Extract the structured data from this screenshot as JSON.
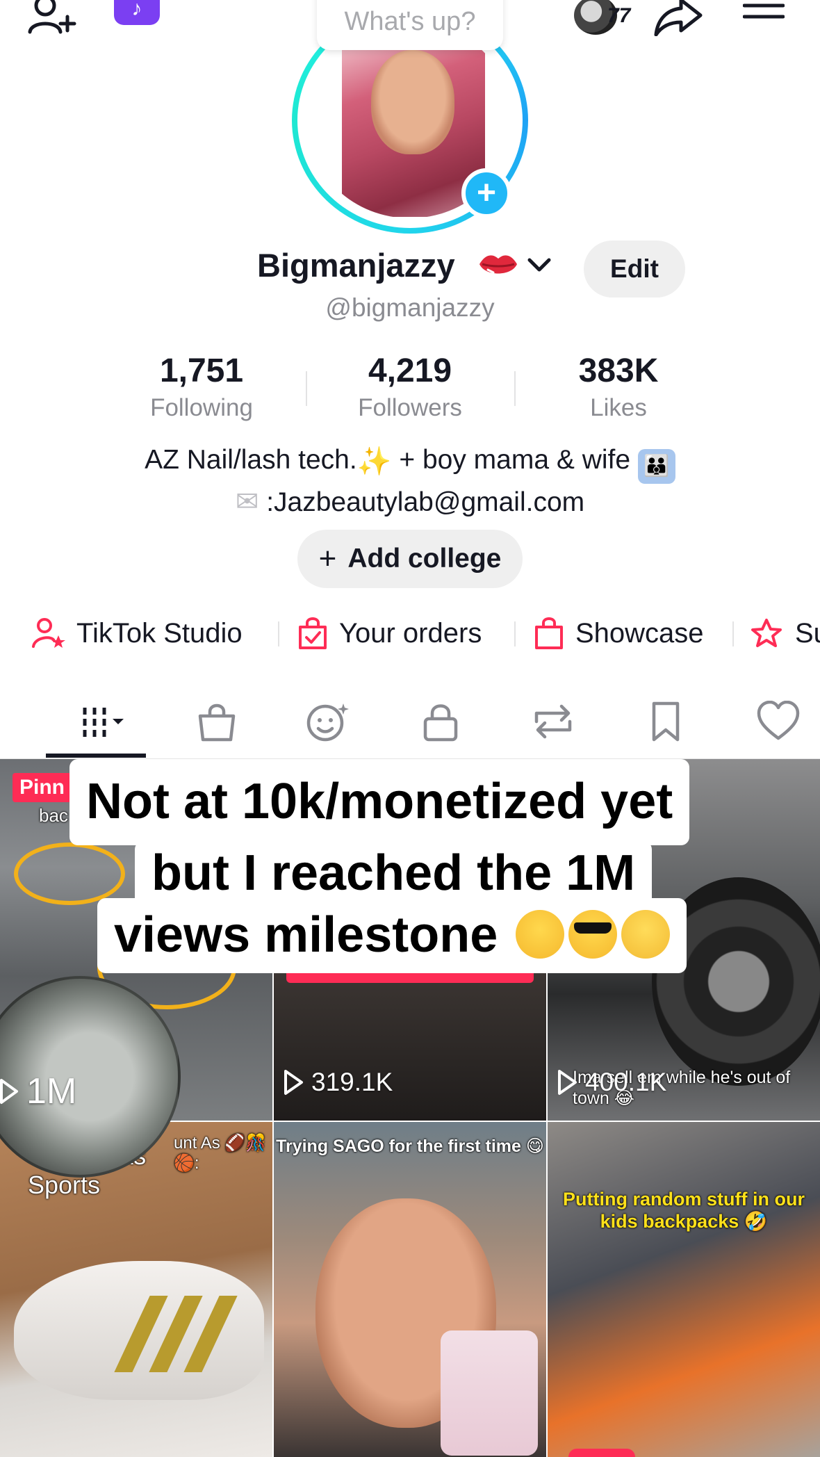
{
  "topbar": {
    "tiktok_badge": "♪",
    "note_placeholder": "What's up?",
    "story_count": "77",
    "icons": [
      "add-friend-icon",
      "tiktok-icon",
      "share-icon",
      "menu-icon"
    ]
  },
  "profile": {
    "display_name": "Bigmanjazzy",
    "name_emoji": "lips",
    "edit_label": "Edit",
    "username": "@bigmanjazzy",
    "avatar_add": "+"
  },
  "stats": [
    {
      "value": "1,751",
      "label": "Following"
    },
    {
      "value": "4,219",
      "label": "Followers"
    },
    {
      "value": "383K",
      "label": "Likes"
    }
  ],
  "bio": {
    "line1_a": "AZ Nail/lash tech.",
    "line1_b": "+ boy mama & wife",
    "line2": ":Jazbeautylab@gmail.com"
  },
  "add_college": {
    "plus": "+",
    "label": "Add college"
  },
  "shortcuts": [
    {
      "label": "TikTok Studio",
      "icon": "studio-icon"
    },
    {
      "label": "Your orders",
      "icon": "orders-icon"
    },
    {
      "label": "Showcase",
      "icon": "showcase-icon"
    },
    {
      "label": "Su",
      "icon": "subscription-icon"
    }
  ],
  "tabs": [
    "videos-grid",
    "shop",
    "favorite-effects",
    "private",
    "reposts",
    "saved",
    "liked"
  ],
  "overlay_caption": {
    "line1": "Not at 10k/monetized yet",
    "line2": "but I reached the 1M",
    "line3": "views milestone"
  },
  "videos": [
    {
      "views": "1M",
      "pinned": "Pinn",
      "caption_top": "bac"
    },
    {
      "views": "319.1K"
    },
    {
      "views": "400.1K",
      "caption": "Ima sell em while he's out of town 😂"
    },
    {
      "caption": "Our Banks Sports",
      "caption_side": "unt As 🏈🎊🏀:"
    },
    {
      "caption": "Trying SAGO for the first time 😋"
    },
    {
      "caption": "Putting random stuff in our kids backpacks 🤣"
    }
  ],
  "colors": {
    "accent": "#fe2c55",
    "ring": "#25f4ee",
    "plus": "#20b8f7",
    "text": "#161823",
    "muted": "#8a8b91"
  }
}
